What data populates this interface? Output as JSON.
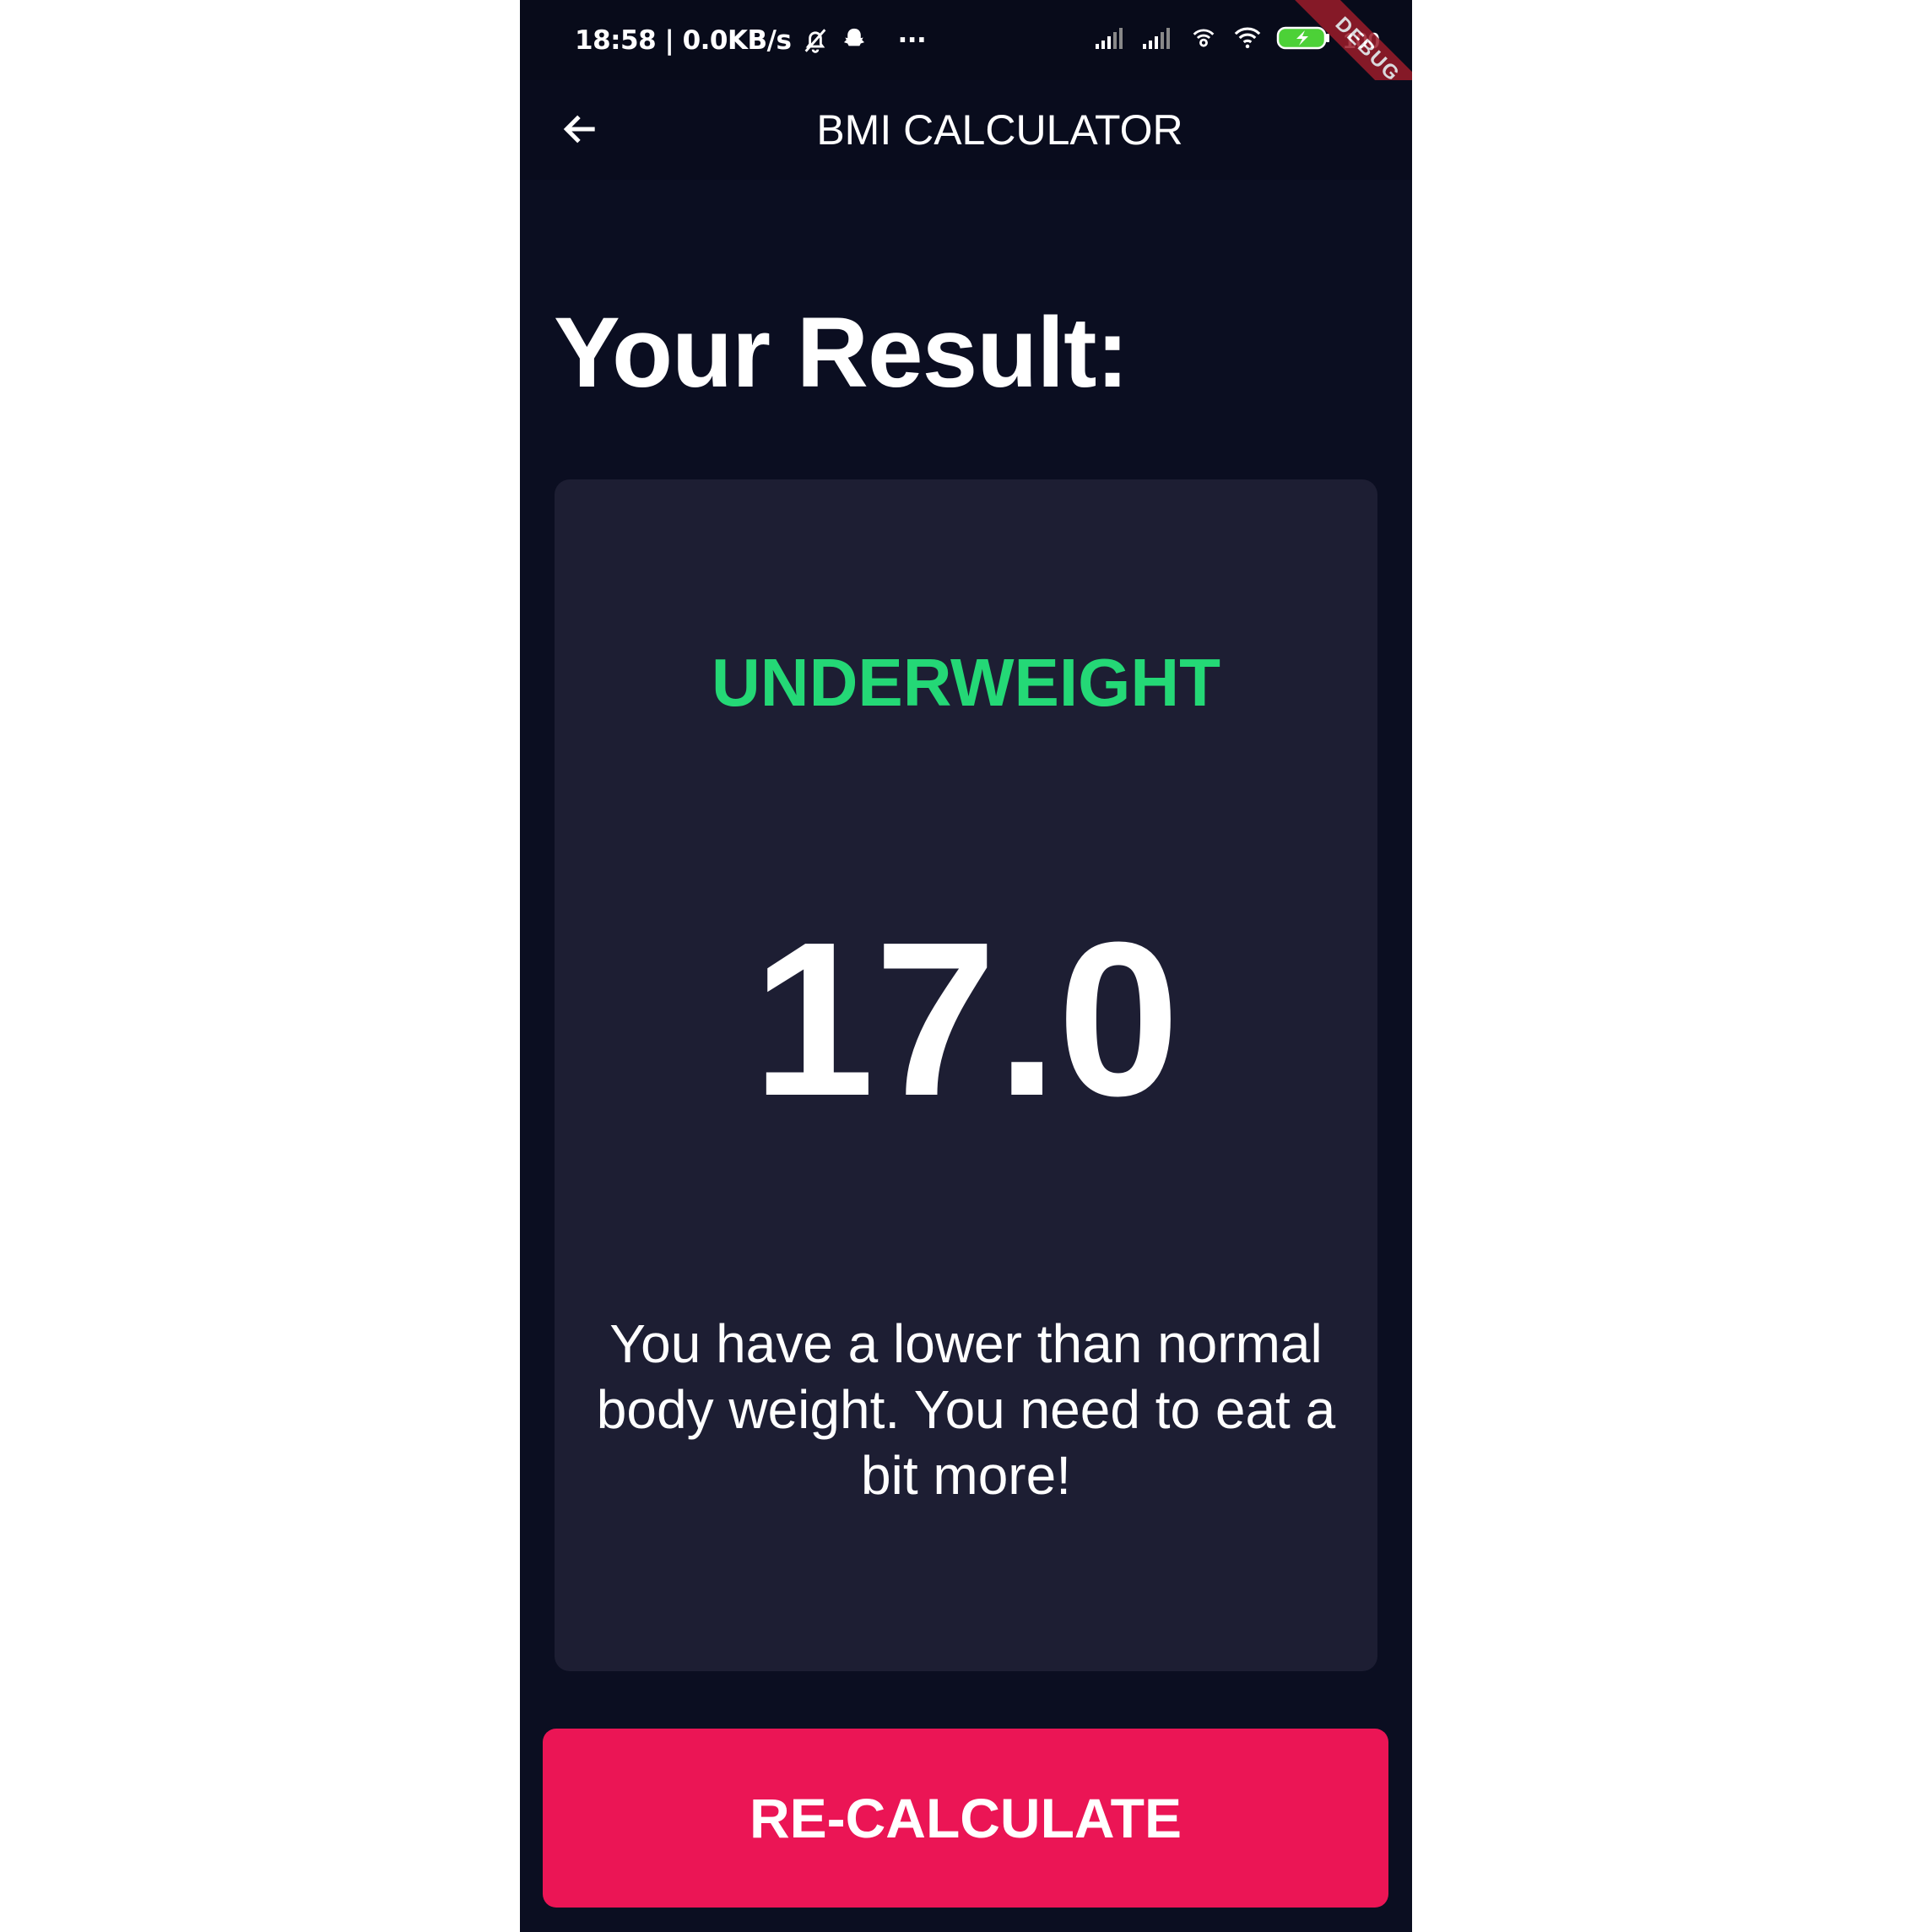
{
  "status_bar": {
    "time_and_speed": "18:58 | 0.0KB/s",
    "more_indicator": "···",
    "battery_text": "100",
    "debug_label": "DEBUG",
    "icons": [
      "mute-bell-icon",
      "snapchat-ghost-icon",
      "signal-icon",
      "signal-icon",
      "hotspot-icon",
      "wifi-icon",
      "battery-charging-icon"
    ]
  },
  "app_bar": {
    "title": "BMI CALCULATOR",
    "back_icon": "arrow-left-icon"
  },
  "main": {
    "heading": "Your Result:",
    "result": {
      "status": "UNDERWEIGHT",
      "bmi": "17.0",
      "interpretation": "You have a lower than normal body weight. You need to eat a bit more!"
    }
  },
  "button": {
    "label": "RE-CALCULATE"
  },
  "colors": {
    "background": "#0b0e21",
    "card": "#1d1e33",
    "status_green": "#24d876",
    "accent": "#eb1555",
    "text": "#ffffff"
  }
}
